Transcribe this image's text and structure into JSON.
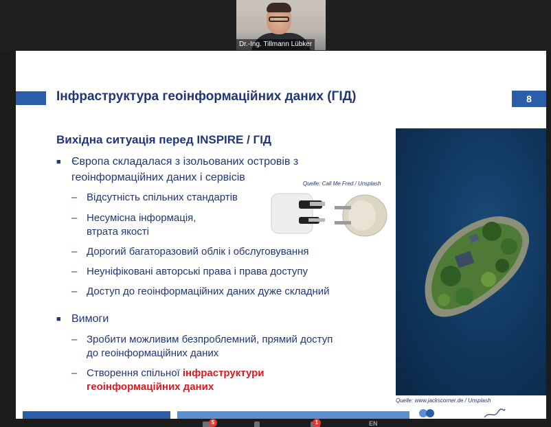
{
  "video": {
    "participant_name": "Dr.-Ing. Tillmann Lübker"
  },
  "slide": {
    "title": "Інфраструктура геоінформаційних даних (ГІД)",
    "page_number": "8",
    "subheading": "Вихідна ситуація перед INSPIRE / ГІД",
    "bullet1": {
      "line1": "Європа складалася з ізольованих островів з",
      "line2": "геоінформаційних даних і сервісів",
      "subs": [
        "Відсутність спільних стандартів",
        "Несумісна інформація,",
        "втрата якості",
        "Дорогий багаторазовий облік і обслуговування",
        "Неуніфіковані авторські права і права доступу",
        "Доступ до геоінформаційних даних дуже складний"
      ]
    },
    "bullet2": {
      "text": "Вимоги",
      "sub1_line1": "Зробити можливим безпроблемний, прямий доступ",
      "sub1_line2": "до геоінформаційних даних",
      "sub2_plain": "Створення спільної ",
      "sub2_red1": "інфраструктури",
      "sub2_red2": "геоінформаційних даних"
    },
    "credit_plug": "Quelle: Call Me Fred / Unsplash",
    "credit_island": "Quelle: www.jackscorner.de / Unsplash"
  },
  "toolbar": {
    "badge_participants": "5",
    "badge_chat": "1",
    "language": "EN"
  },
  "colors": {
    "title_blue": "#20357a",
    "accent_blue": "#2a5ea8",
    "highlight_red": "#e0171e"
  }
}
